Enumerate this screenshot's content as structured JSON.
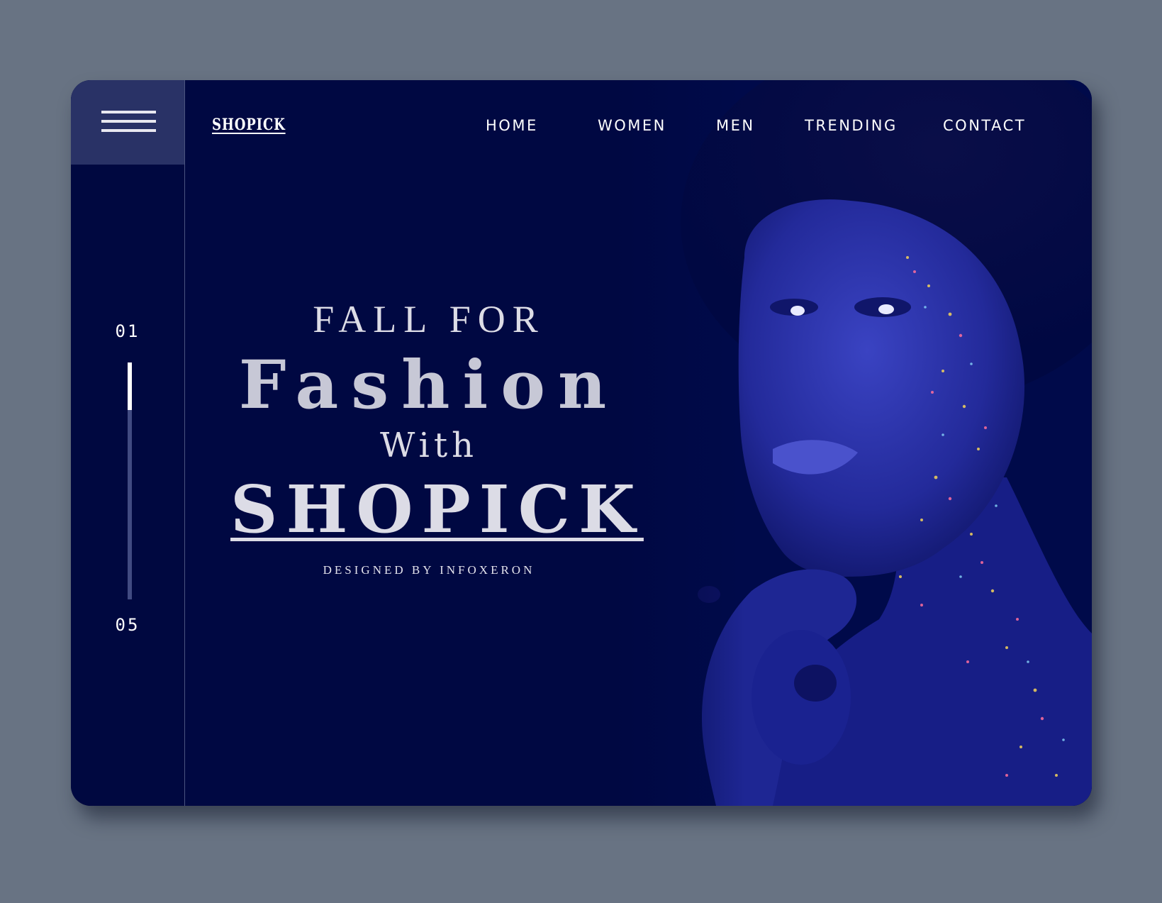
{
  "brand": {
    "logo_text": "SHOPICK"
  },
  "nav": {
    "items": [
      "HOME",
      "WOMEN",
      "MEN",
      "TRENDING",
      "CONTACT"
    ]
  },
  "slider": {
    "current": "01",
    "total": "05",
    "progress_fraction": 0.2
  },
  "hero": {
    "line1": "FALL FOR",
    "line2": "Fashion",
    "line3": "With",
    "line4": "SHOPICK",
    "credit": "DESIGNED BY INFOXERON"
  },
  "colors": {
    "page_background": "#687383",
    "card_background": "#000842",
    "menu_button_background": "#293266",
    "accent_text": "#dcdce6",
    "track": "#414b82"
  },
  "icons": {
    "menu": "hamburger-icon"
  },
  "image": {
    "subject": "hero-portrait"
  }
}
